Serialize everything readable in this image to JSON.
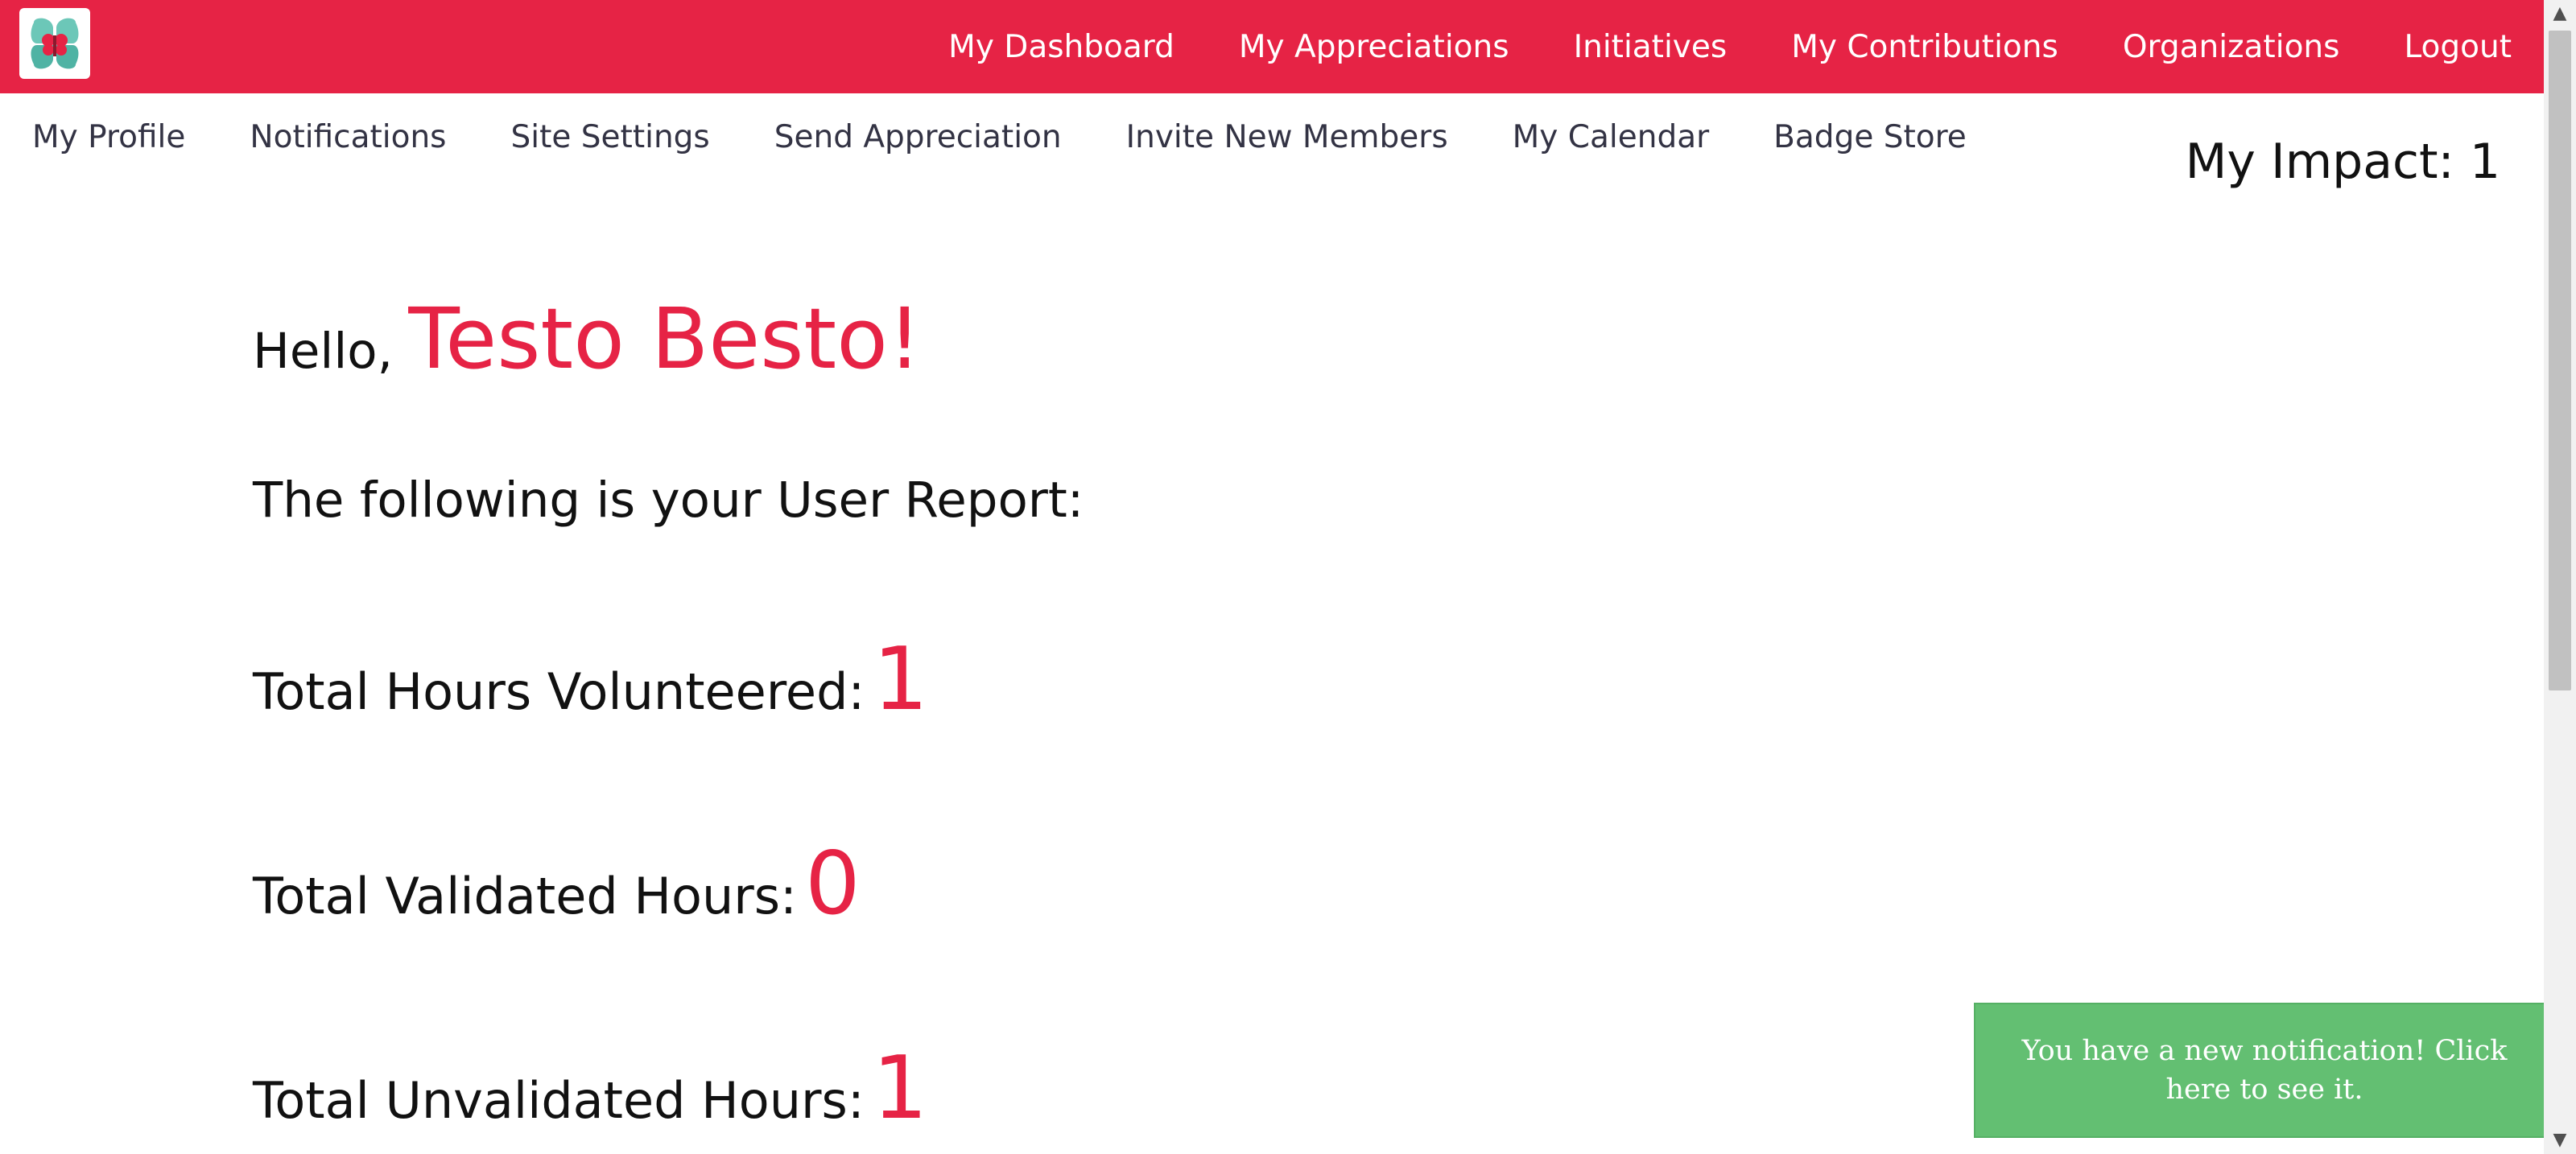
{
  "brand": {
    "logo_icon": "butterfly-logo-icon",
    "accent_color": "#e62345"
  },
  "topnav": {
    "items": [
      {
        "label": "My Dashboard"
      },
      {
        "label": "My Appreciations"
      },
      {
        "label": "Initiatives"
      },
      {
        "label": "My Contributions"
      },
      {
        "label": "Organizations"
      },
      {
        "label": "Logout"
      }
    ]
  },
  "subnav": {
    "items": [
      {
        "label": "My Profile"
      },
      {
        "label": "Notifications"
      },
      {
        "label": "Site Settings"
      },
      {
        "label": "Send Appreciation"
      },
      {
        "label": "Invite New Members"
      },
      {
        "label": "My Calendar"
      },
      {
        "label": "Badge Store"
      }
    ]
  },
  "impact": {
    "label": "My Impact:",
    "value": "1"
  },
  "greeting": {
    "hello": "Hello,",
    "name": "Testo Besto!"
  },
  "report": {
    "heading": "The following is your User Report:",
    "stats": [
      {
        "label": "Total Hours Volunteered:",
        "value": "1"
      },
      {
        "label": "Total Validated Hours:",
        "value": "0"
      },
      {
        "label": "Total Unvalidated Hours:",
        "value": "1"
      }
    ]
  },
  "toast": {
    "text": "You have a new notification! Click here to see it.",
    "color": "#63bf72"
  }
}
